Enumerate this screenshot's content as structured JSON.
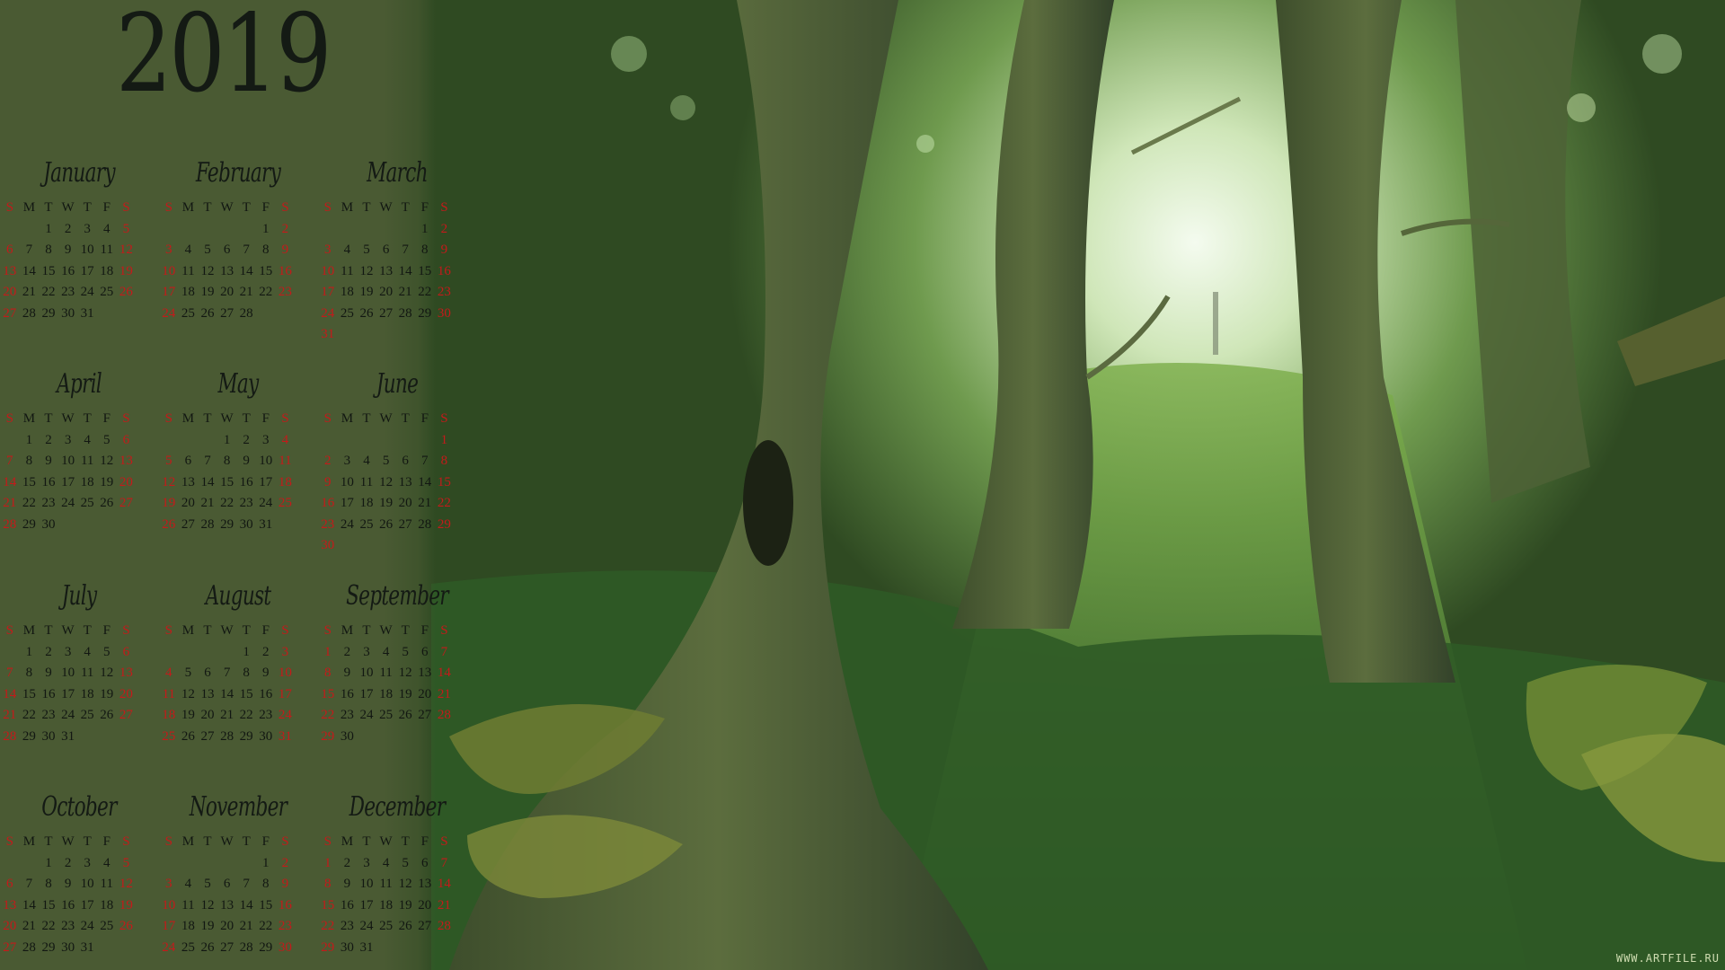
{
  "year": "2019",
  "weekday_headers": [
    "S",
    "M",
    "T",
    "W",
    "T",
    "F",
    "S"
  ],
  "months": [
    {
      "name": "January",
      "first_weekday": 2,
      "days": 31
    },
    {
      "name": "February",
      "first_weekday": 5,
      "days": 28
    },
    {
      "name": "March",
      "first_weekday": 5,
      "days": 31
    },
    {
      "name": "April",
      "first_weekday": 1,
      "days": 30
    },
    {
      "name": "May",
      "first_weekday": 3,
      "days": 31
    },
    {
      "name": "June",
      "first_weekday": 6,
      "days": 30
    },
    {
      "name": "July",
      "first_weekday": 1,
      "days": 31
    },
    {
      "name": "August",
      "first_weekday": 4,
      "days": 31
    },
    {
      "name": "September",
      "first_weekday": 0,
      "days": 30
    },
    {
      "name": "October",
      "first_weekday": 2,
      "days": 31
    },
    {
      "name": "November",
      "first_weekday": 5,
      "days": 30
    },
    {
      "name": "December",
      "first_weekday": 0,
      "days": 31
    }
  ],
  "watermark": "WWW.ARTFILE.RU",
  "colors": {
    "panel": "#4a5a33",
    "weekend": "#c41a1a",
    "text": "#121712"
  }
}
